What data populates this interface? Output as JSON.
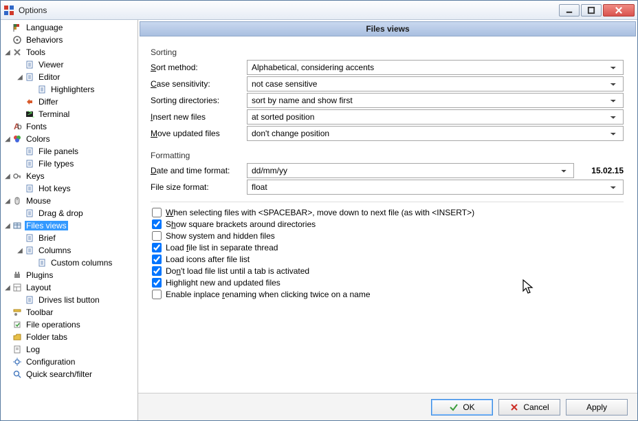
{
  "window": {
    "title": "Options"
  },
  "tree": [
    {
      "d": 0,
      "exp": null,
      "icon": "flag",
      "label": "Language"
    },
    {
      "d": 0,
      "exp": null,
      "icon": "behaviors",
      "label": "Behaviors"
    },
    {
      "d": 0,
      "exp": "open",
      "icon": "tools",
      "label": "Tools"
    },
    {
      "d": 1,
      "exp": null,
      "icon": "page",
      "label": "Viewer"
    },
    {
      "d": 1,
      "exp": "open",
      "icon": "page",
      "label": "Editor"
    },
    {
      "d": 2,
      "exp": null,
      "icon": "page",
      "label": "Highlighters"
    },
    {
      "d": 1,
      "exp": null,
      "icon": "differ",
      "label": "Differ"
    },
    {
      "d": 1,
      "exp": null,
      "icon": "terminal",
      "label": "Terminal"
    },
    {
      "d": 0,
      "exp": null,
      "icon": "fonts",
      "label": "Fonts"
    },
    {
      "d": 0,
      "exp": "open",
      "icon": "colors",
      "label": "Colors"
    },
    {
      "d": 1,
      "exp": null,
      "icon": "page",
      "label": "File panels"
    },
    {
      "d": 1,
      "exp": null,
      "icon": "page",
      "label": "File types"
    },
    {
      "d": 0,
      "exp": "open",
      "icon": "keys",
      "label": "Keys"
    },
    {
      "d": 1,
      "exp": null,
      "icon": "page",
      "label": "Hot keys"
    },
    {
      "d": 0,
      "exp": "open",
      "icon": "mouse",
      "label": "Mouse"
    },
    {
      "d": 1,
      "exp": null,
      "icon": "page",
      "label": "Drag & drop"
    },
    {
      "d": 0,
      "exp": "open",
      "icon": "view",
      "label": "Files views",
      "selected": true
    },
    {
      "d": 1,
      "exp": null,
      "icon": "page",
      "label": "Brief"
    },
    {
      "d": 1,
      "exp": "open",
      "icon": "page",
      "label": "Columns"
    },
    {
      "d": 2,
      "exp": null,
      "icon": "page",
      "label": "Custom columns"
    },
    {
      "d": 0,
      "exp": null,
      "icon": "plugins",
      "label": "Plugins"
    },
    {
      "d": 0,
      "exp": "open",
      "icon": "layout",
      "label": "Layout"
    },
    {
      "d": 1,
      "exp": null,
      "icon": "page",
      "label": "Drives list button"
    },
    {
      "d": 0,
      "exp": null,
      "icon": "toolbar",
      "label": "Toolbar"
    },
    {
      "d": 0,
      "exp": null,
      "icon": "fileops",
      "label": "File operations"
    },
    {
      "d": 0,
      "exp": null,
      "icon": "folder",
      "label": "Folder tabs"
    },
    {
      "d": 0,
      "exp": null,
      "icon": "log",
      "label": "Log"
    },
    {
      "d": 0,
      "exp": null,
      "icon": "config",
      "label": "Configuration"
    },
    {
      "d": 0,
      "exp": null,
      "icon": "search",
      "label": "Quick search/filter"
    }
  ],
  "content": {
    "title": "Files views",
    "sorting": {
      "group_label": "Sorting",
      "sort_method": {
        "label": "Sort method:",
        "value": "Alphabetical, considering accents"
      },
      "case": {
        "label": "Case sensitivity:",
        "value": "not case sensitive"
      },
      "directories": {
        "label": "Sorting directories:",
        "value": "sort by name and show first"
      },
      "insert": {
        "label": "Insert new files",
        "value": "at sorted position"
      },
      "move": {
        "label": "Move updated files",
        "value": "don't change position"
      }
    },
    "formatting": {
      "group_label": "Formatting",
      "date": {
        "label": "Date and time format:",
        "value": "dd/mm/yy",
        "sample": "15.02.15"
      },
      "size": {
        "label": "File size format:",
        "value": "float"
      }
    },
    "checks": {
      "spacebar": {
        "checked": false,
        "label": "When selecting files with <SPACEBAR>, move down to next file (as with <INSERT>)"
      },
      "brackets": {
        "checked": true,
        "label": "Show square brackets around directories"
      },
      "hidden": {
        "checked": false,
        "label": "Show system and hidden files"
      },
      "thread": {
        "checked": true,
        "label": "Load file list in separate thread"
      },
      "icons": {
        "checked": true,
        "label": "Load icons after file list"
      },
      "lazytab": {
        "checked": true,
        "label": "Don't load file list until a tab is activated"
      },
      "highlight": {
        "checked": true,
        "label": "Highlight new and updated files"
      },
      "rename": {
        "checked": false,
        "label": "Enable inplace renaming when clicking twice on a name"
      }
    }
  },
  "footer": {
    "ok": "OK",
    "cancel": "Cancel",
    "apply": "Apply"
  }
}
